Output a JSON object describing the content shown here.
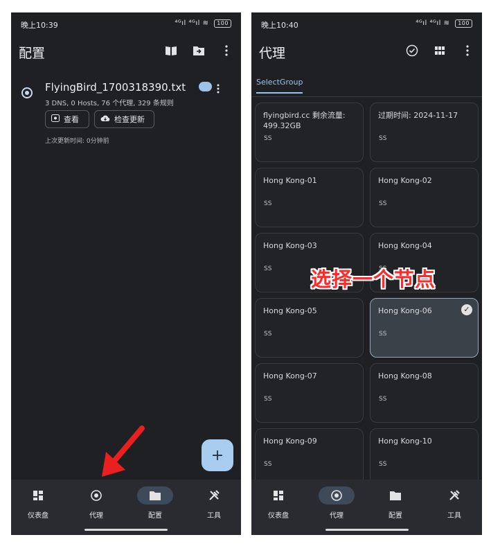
{
  "left": {
    "status": {
      "time": "晚上10:39",
      "signal": "⁴ᴳıl ⁴ᴳıl",
      "battery": "100"
    },
    "title": "配置",
    "profile": {
      "name": "FlyingBird_1700318390.txt",
      "desc": "3 DNS, 0 Hosts, 76 个代理, 329 条规则",
      "view_label": "查看",
      "update_label": "检查更新",
      "updated": "上次更新时间: 0分钟前"
    },
    "fab_label": "+"
  },
  "right": {
    "status": {
      "time": "晚上10:40",
      "signal": "⁴ᴳıl ⁴ᴳıl",
      "battery": "100"
    },
    "title": "代理",
    "tab": "SelectGroup",
    "cards": [
      {
        "title": "flyingbird.cc 剩余流量:\n499.32GB",
        "sub": "SS"
      },
      {
        "title": "过期时间: 2024-11-17",
        "sub": "SS"
      },
      {
        "title": "Hong Kong-01",
        "sub": "SS"
      },
      {
        "title": "Hong Kong-02",
        "sub": "SS"
      },
      {
        "title": "Hong Kong-03",
        "sub": "SS"
      },
      {
        "title": "Hong Kong-04",
        "sub": "SS"
      },
      {
        "title": "Hong Kong-05",
        "sub": "SS"
      },
      {
        "title": "Hong Kong-06",
        "sub": "SS",
        "selected": true
      },
      {
        "title": "Hong Kong-07",
        "sub": "SS"
      },
      {
        "title": "Hong Kong-08",
        "sub": "SS"
      },
      {
        "title": "Hong Kong-09",
        "sub": "SS"
      },
      {
        "title": "Hong Kong-10",
        "sub": "SS"
      }
    ]
  },
  "nav": {
    "dashboard": "仪表盘",
    "proxy": "代理",
    "profiles": "配置",
    "tools": "工具"
  },
  "overlay": "选择一个节点",
  "icons": [
    "book-icon",
    "folder-import-icon",
    "more-vert-icon",
    "check-circle-icon",
    "grid-icon",
    "eye-icon",
    "cloud-download-icon",
    "dashboard-icon",
    "radio-target-icon",
    "folder-icon",
    "tools-icon",
    "arrow-icon"
  ],
  "colors": {
    "background": "#1f2024",
    "accent": "#9cc4ec",
    "fab": "#a9cdf0",
    "annotation": "#ff2a2a"
  }
}
